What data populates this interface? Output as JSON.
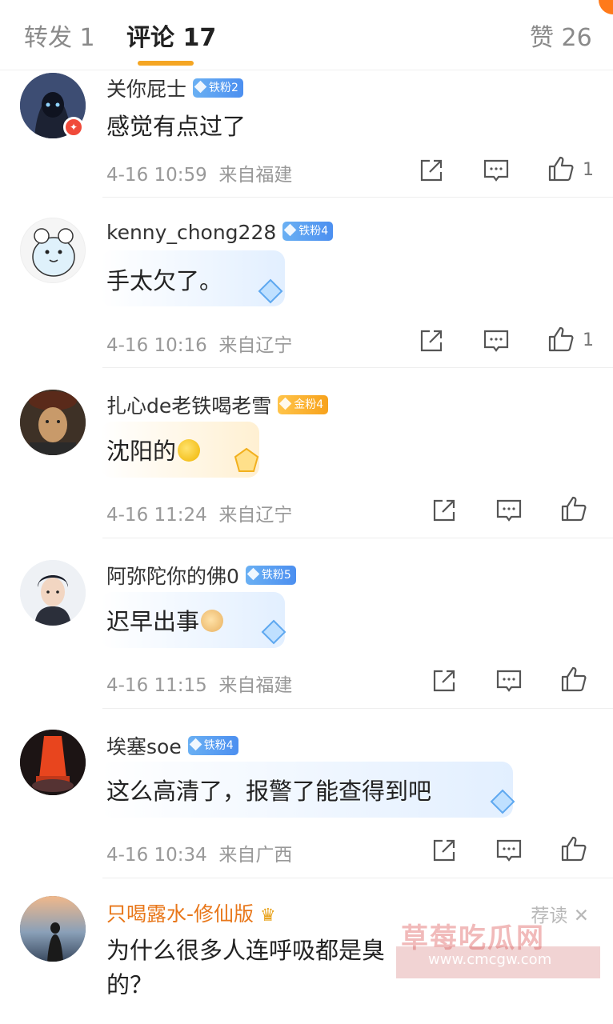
{
  "tabs": {
    "repost": "转发 1",
    "comments": "评论 17",
    "likes": "赞 26"
  },
  "colors": {
    "accent": "#f5a623",
    "iron_badge": "#4c8ff0",
    "gold_badge": "#f7a21c",
    "vip_name": "#e8771a"
  },
  "comments": [
    {
      "username": "关你屁士",
      "badge": "铁粉2",
      "text": "感觉有点过了",
      "time": "4-16 10:59",
      "location": "来自福建",
      "likes": "1"
    },
    {
      "username": "kenny_chong228",
      "badge": "铁粉4",
      "text": "手太欠了。",
      "time": "4-16 10:16",
      "location": "来自辽宁",
      "likes": "1"
    },
    {
      "username": "扎心de老铁喝老雪",
      "badge": "金粉4",
      "text": "沈阳的",
      "time": "4-16 11:24",
      "location": "来自辽宁",
      "likes": ""
    },
    {
      "username": "阿弥陀你的佛0",
      "badge": "铁粉5",
      "text": "迟早出事",
      "time": "4-16 11:15",
      "location": "来自福建",
      "likes": ""
    },
    {
      "username": "埃塞soe",
      "badge": "铁粉4",
      "text": "这么高清了，报警了能查得到吧",
      "time": "4-16 10:34",
      "location": "来自广西",
      "likes": ""
    },
    {
      "username": "只喝露水-修仙版",
      "text_line1": "为什么很多人连呼吸都是臭",
      "text_line2": "的？",
      "recommend": "荐读 ✕"
    }
  ],
  "watermark": {
    "title": "草莓吃瓜网",
    "url": "www.cmcgw.com"
  }
}
